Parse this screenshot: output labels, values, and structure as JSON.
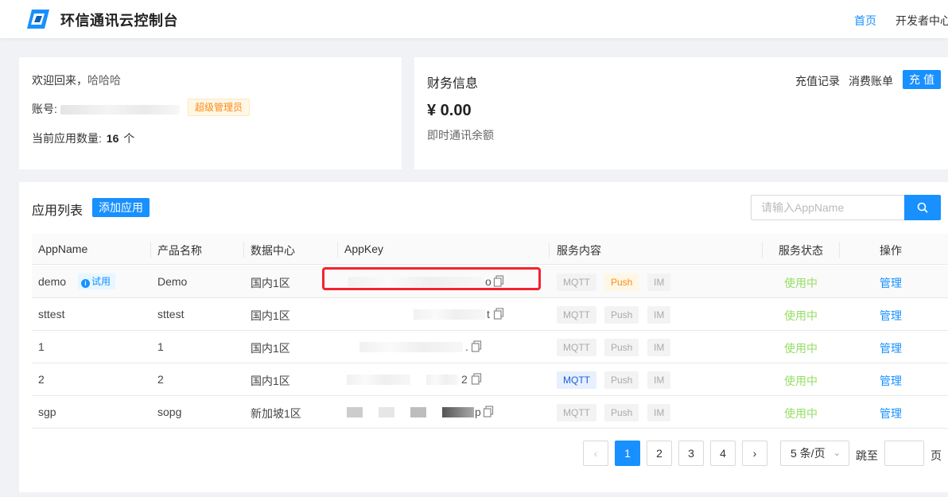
{
  "header": {
    "brand": "环信通讯云控制台",
    "nav": [
      "首页",
      "开发者中心"
    ]
  },
  "welcome": {
    "greeting": "欢迎回来，",
    "username": "哈哈哈",
    "account_label": "账号:",
    "role": "超级管理员",
    "app_count_label": "当前应用数量:",
    "app_count": "16",
    "app_count_unit": "个"
  },
  "finance": {
    "title": "财务信息",
    "recharge_records": "充值记录",
    "bills": "消费账单",
    "recharge_button": "充值",
    "balance": "¥ 0.00",
    "balance_label": "即时通讯余额"
  },
  "apps": {
    "title": "应用列表",
    "add_button": "添加应用",
    "search_placeholder": "请输入AppName",
    "columns": [
      "AppName",
      "产品名称",
      "数据中心",
      "AppKey",
      "服务内容",
      "服务状态",
      "操作"
    ],
    "trial_label": "试用",
    "rows": [
      {
        "app_name": "demo",
        "product": "Demo",
        "datacenter": "国内1区",
        "key_tail": "o",
        "services": {
          "mqtt": false,
          "push": true,
          "im": false
        },
        "status": "使用中",
        "action": "管理"
      },
      {
        "app_name": "sttest",
        "product": "sttest",
        "datacenter": "国内1区",
        "key_tail": "t",
        "services": {
          "mqtt": false,
          "push": false,
          "im": false
        },
        "status": "使用中",
        "action": "管理"
      },
      {
        "app_name": "1",
        "product": "1",
        "datacenter": "国内1区",
        "key_tail": ".",
        "services": {
          "mqtt": false,
          "push": false,
          "im": false
        },
        "status": "使用中",
        "action": "管理"
      },
      {
        "app_name": "2",
        "product": "2",
        "datacenter": "国内1区",
        "key_tail": "2",
        "services": {
          "mqtt": true,
          "push": false,
          "im": false
        },
        "status": "使用中",
        "action": "管理"
      },
      {
        "app_name": "sgp",
        "product": "sopg",
        "datacenter": "新加坡1区",
        "key_tail": "p",
        "services": {
          "mqtt": false,
          "push": false,
          "im": false
        },
        "status": "使用中",
        "action": "管理"
      }
    ],
    "service_labels": {
      "mqtt": "MQTT",
      "push": "Push",
      "im": "IM"
    }
  },
  "pagination": {
    "prev": "‹",
    "next": "›",
    "pages": [
      "1",
      "2",
      "3",
      "4"
    ],
    "current": "1",
    "page_size": "5 条/页",
    "jump_label": "跳至",
    "jump_unit": "页"
  },
  "colors": {
    "primary": "#1890ff",
    "status_active": "#95de64",
    "role_tag": "#fa8c16",
    "highlight": "#f5222d"
  }
}
